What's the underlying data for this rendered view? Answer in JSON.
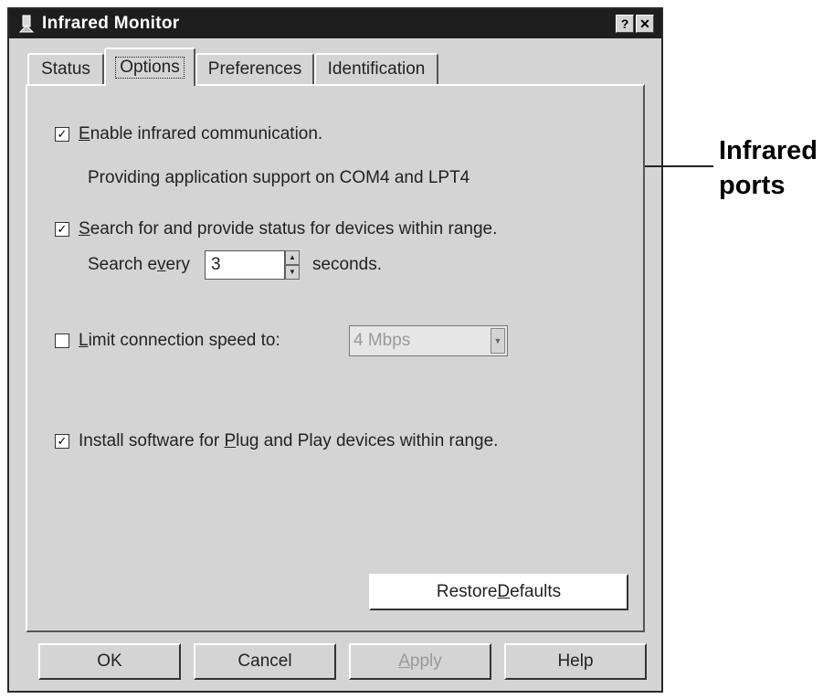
{
  "window": {
    "title": "Infrared Monitor",
    "help_glyph": "?",
    "close_glyph": "✕"
  },
  "tabs": [
    {
      "label": "Status",
      "active": false
    },
    {
      "label": "Options",
      "active": true
    },
    {
      "label": "Preferences",
      "active": false
    },
    {
      "label": "Identification",
      "active": false
    }
  ],
  "options": {
    "enable_ir": {
      "checked": true,
      "pre": "",
      "mnemonic": "E",
      "post": "nable infrared communication."
    },
    "port_info": "Providing application support on COM4 and LPT4",
    "search_status": {
      "checked": true,
      "pre": "",
      "mnemonic": "S",
      "post": "earch for and provide status for devices within range."
    },
    "search_every": {
      "pre": "Search e",
      "mnemonic": "v",
      "post": "ery",
      "value": "3",
      "suffix": "seconds."
    },
    "limit_speed": {
      "checked": false,
      "pre": "",
      "mnemonic": "L",
      "post": "imit connection speed to:",
      "selected": "4 Mbps"
    },
    "install_pnp": {
      "checked": true,
      "pre": "Install software for ",
      "mnemonic": "P",
      "post": "lug and Play devices within range."
    },
    "restore": {
      "pre": "Restore ",
      "mnemonic": "D",
      "post": "efaults"
    }
  },
  "footer": {
    "ok": "OK",
    "cancel": "Cancel",
    "apply": {
      "pre": "",
      "mnemonic": "A",
      "post": "pply",
      "disabled": true
    },
    "help": "Help"
  },
  "callout": {
    "label_line1": "Infrared",
    "label_line2": "ports"
  },
  "icons": {
    "app": "infrared-monitor-icon",
    "check": "✓"
  }
}
